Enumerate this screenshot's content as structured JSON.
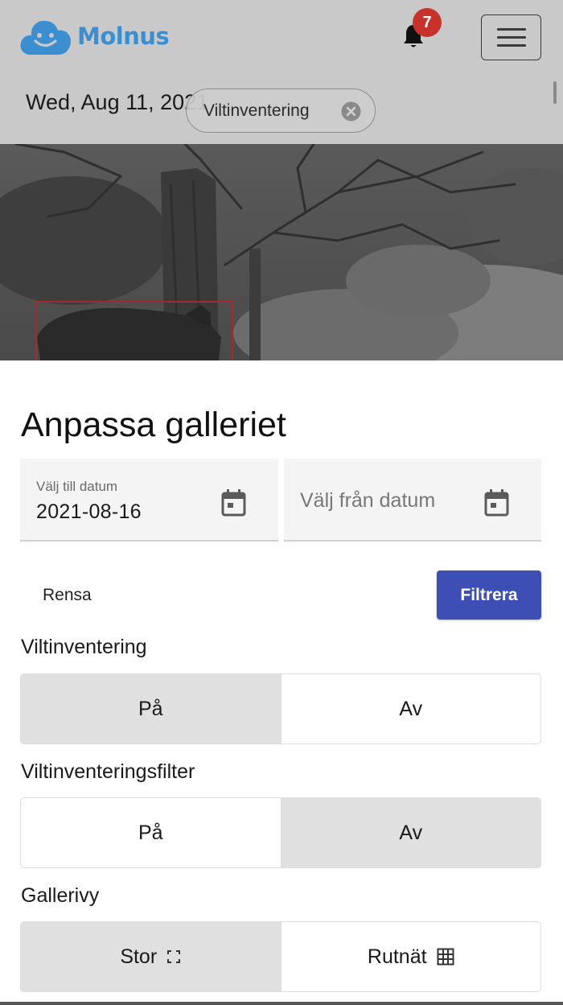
{
  "header": {
    "logo_text": "Molnus",
    "notifications_count": "7",
    "brand_color": "#3b8fd0",
    "badge_color": "#c8322a",
    "icons": [
      "cloud-logo-icon",
      "bell-icon",
      "hamburger-menu-icon"
    ]
  },
  "background": {
    "date": "Wed, Aug 11, 2021",
    "filter_chip": "Viltinventering"
  },
  "sheet": {
    "title": "Anpassa galleriet",
    "to_date": {
      "label": "Välj till datum",
      "value": "2021-08-16"
    },
    "from_date": {
      "placeholder": "Välj från datum"
    },
    "clear_label": "Rensa",
    "filter_label": "Filtrera",
    "filter_button_color": "#3d4fb5",
    "sections": {
      "viltinventering": {
        "label": "Viltinventering",
        "on": "På",
        "off": "Av",
        "selected": "on"
      },
      "viltinventeringsfilter": {
        "label": "Viltinventeringsfilter",
        "on": "På",
        "off": "Av",
        "selected": "off"
      },
      "gallerivy": {
        "label": "Gallerivy",
        "large": "Stor",
        "grid": "Rutnät",
        "selected": "large"
      }
    }
  }
}
